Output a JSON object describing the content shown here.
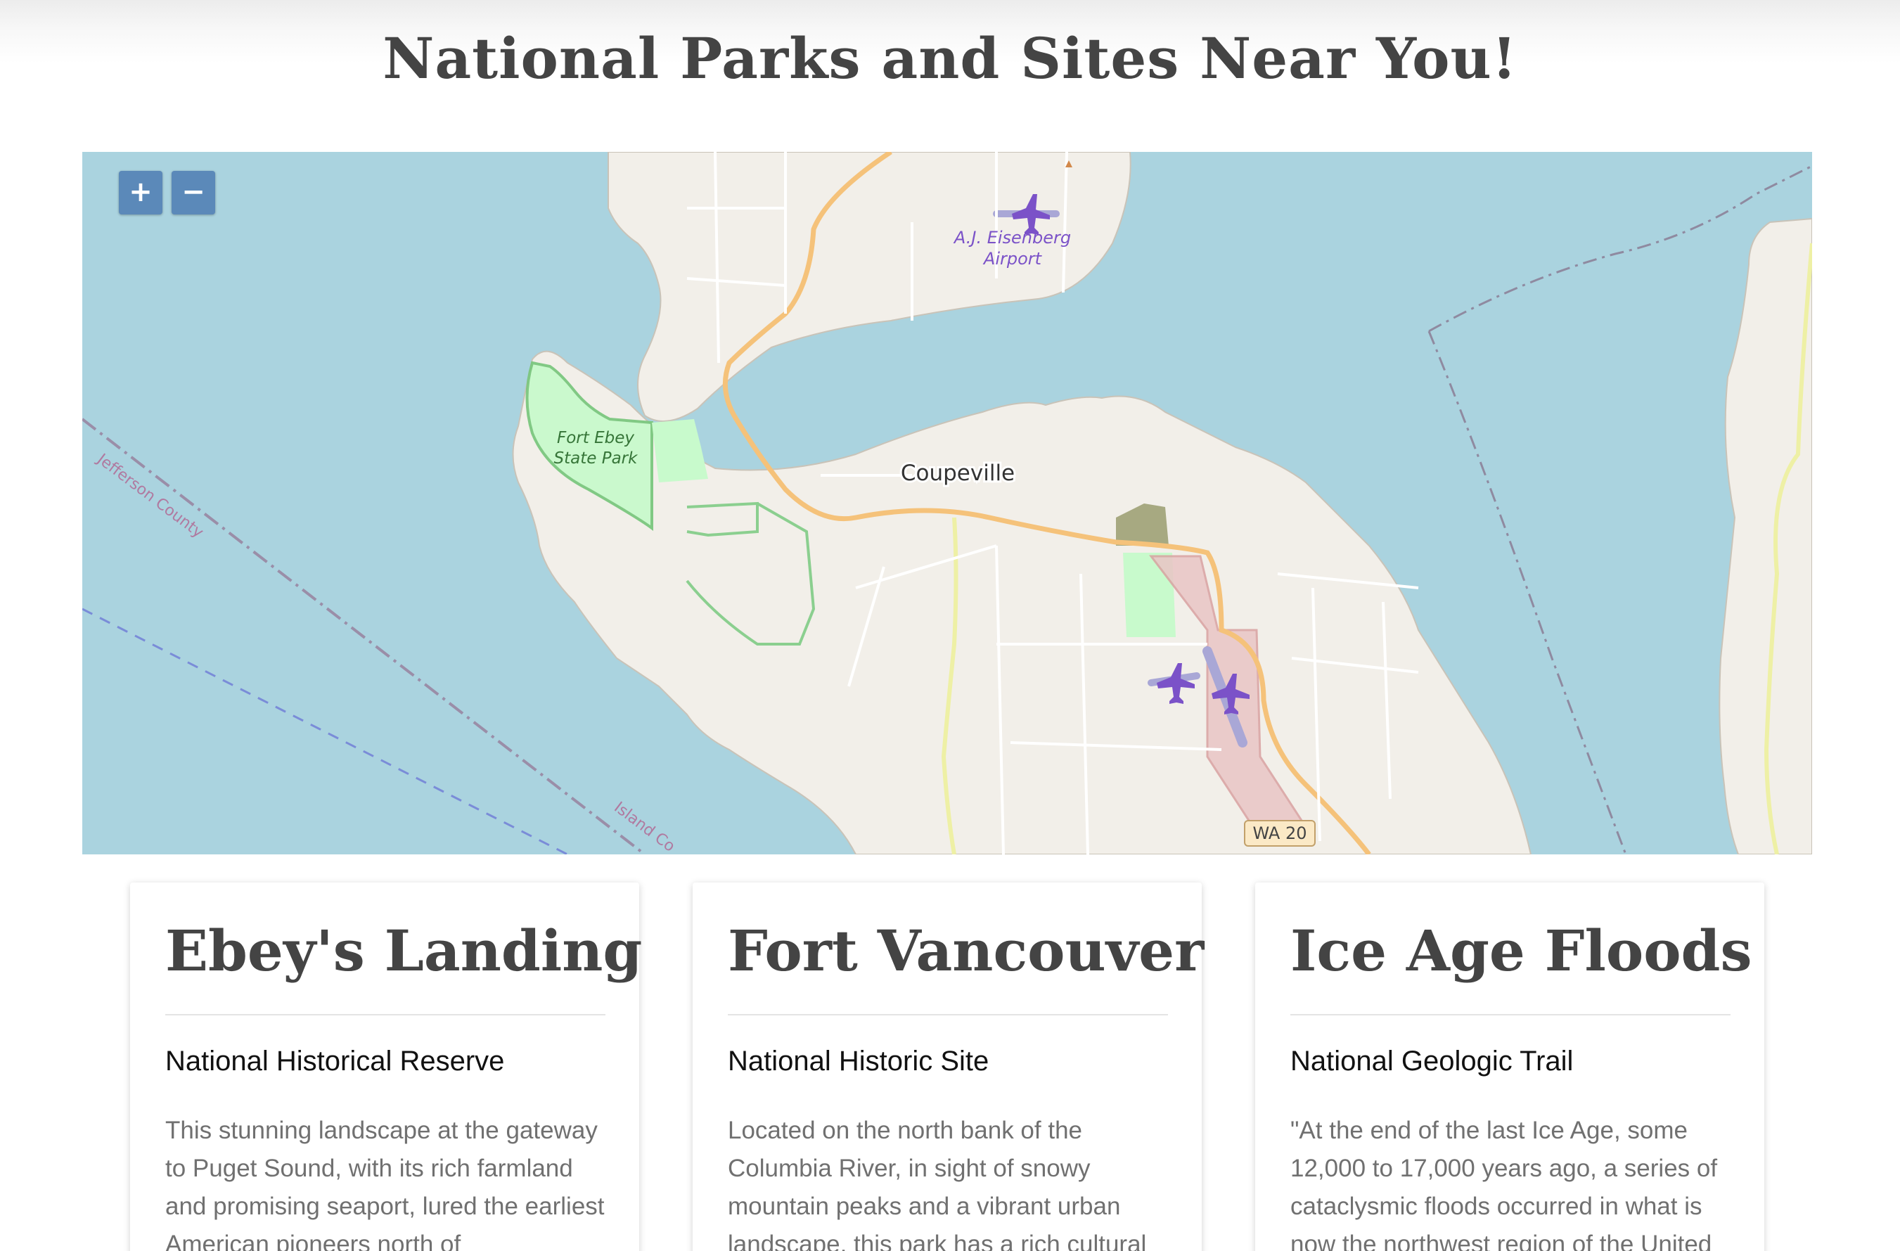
{
  "page": {
    "title": "National Parks and Sites Near You!"
  },
  "map": {
    "zoom_in_label": "+",
    "zoom_out_label": "−",
    "labels": {
      "airport": "A.J. Eisenberg Airport",
      "airport_line1": "A.J. Eisenberg",
      "airport_line2": "Airport",
      "park": "Fort Ebey State Park",
      "park_line1": "Fort Ebey",
      "park_line2": "State Park",
      "town": "Coupeville",
      "county1": "Jefferson County",
      "county2": "Island Co",
      "highway": "WA 20"
    },
    "colors": {
      "water": "#aad3df",
      "land": "#f2efe9",
      "park": "#c8facc",
      "major_road": "#f5c27a",
      "airport_icon": "#7b52c8",
      "zoom_button": "#5b89b9"
    }
  },
  "cards": [
    {
      "title": "Ebey's Landing",
      "subtitle": "National Historical Reserve",
      "body": "This stunning landscape at the gateway to Puget Sound, with its rich farmland and promising seaport, lured the earliest American pioneers north of"
    },
    {
      "title": "Fort Vancouver",
      "subtitle": "National Historic Site",
      "body": "Located on the north bank of the Columbia River, in sight of snowy mountain peaks and a vibrant urban landscape, this park has a rich cultural"
    },
    {
      "title": "Ice Age Floods",
      "subtitle": "National Geologic Trail",
      "body": "\"At the end of the last Ice Age, some 12,000 to 17,000 years ago, a series of cataclysmic floods occurred in what is now the northwest region of the United"
    }
  ]
}
